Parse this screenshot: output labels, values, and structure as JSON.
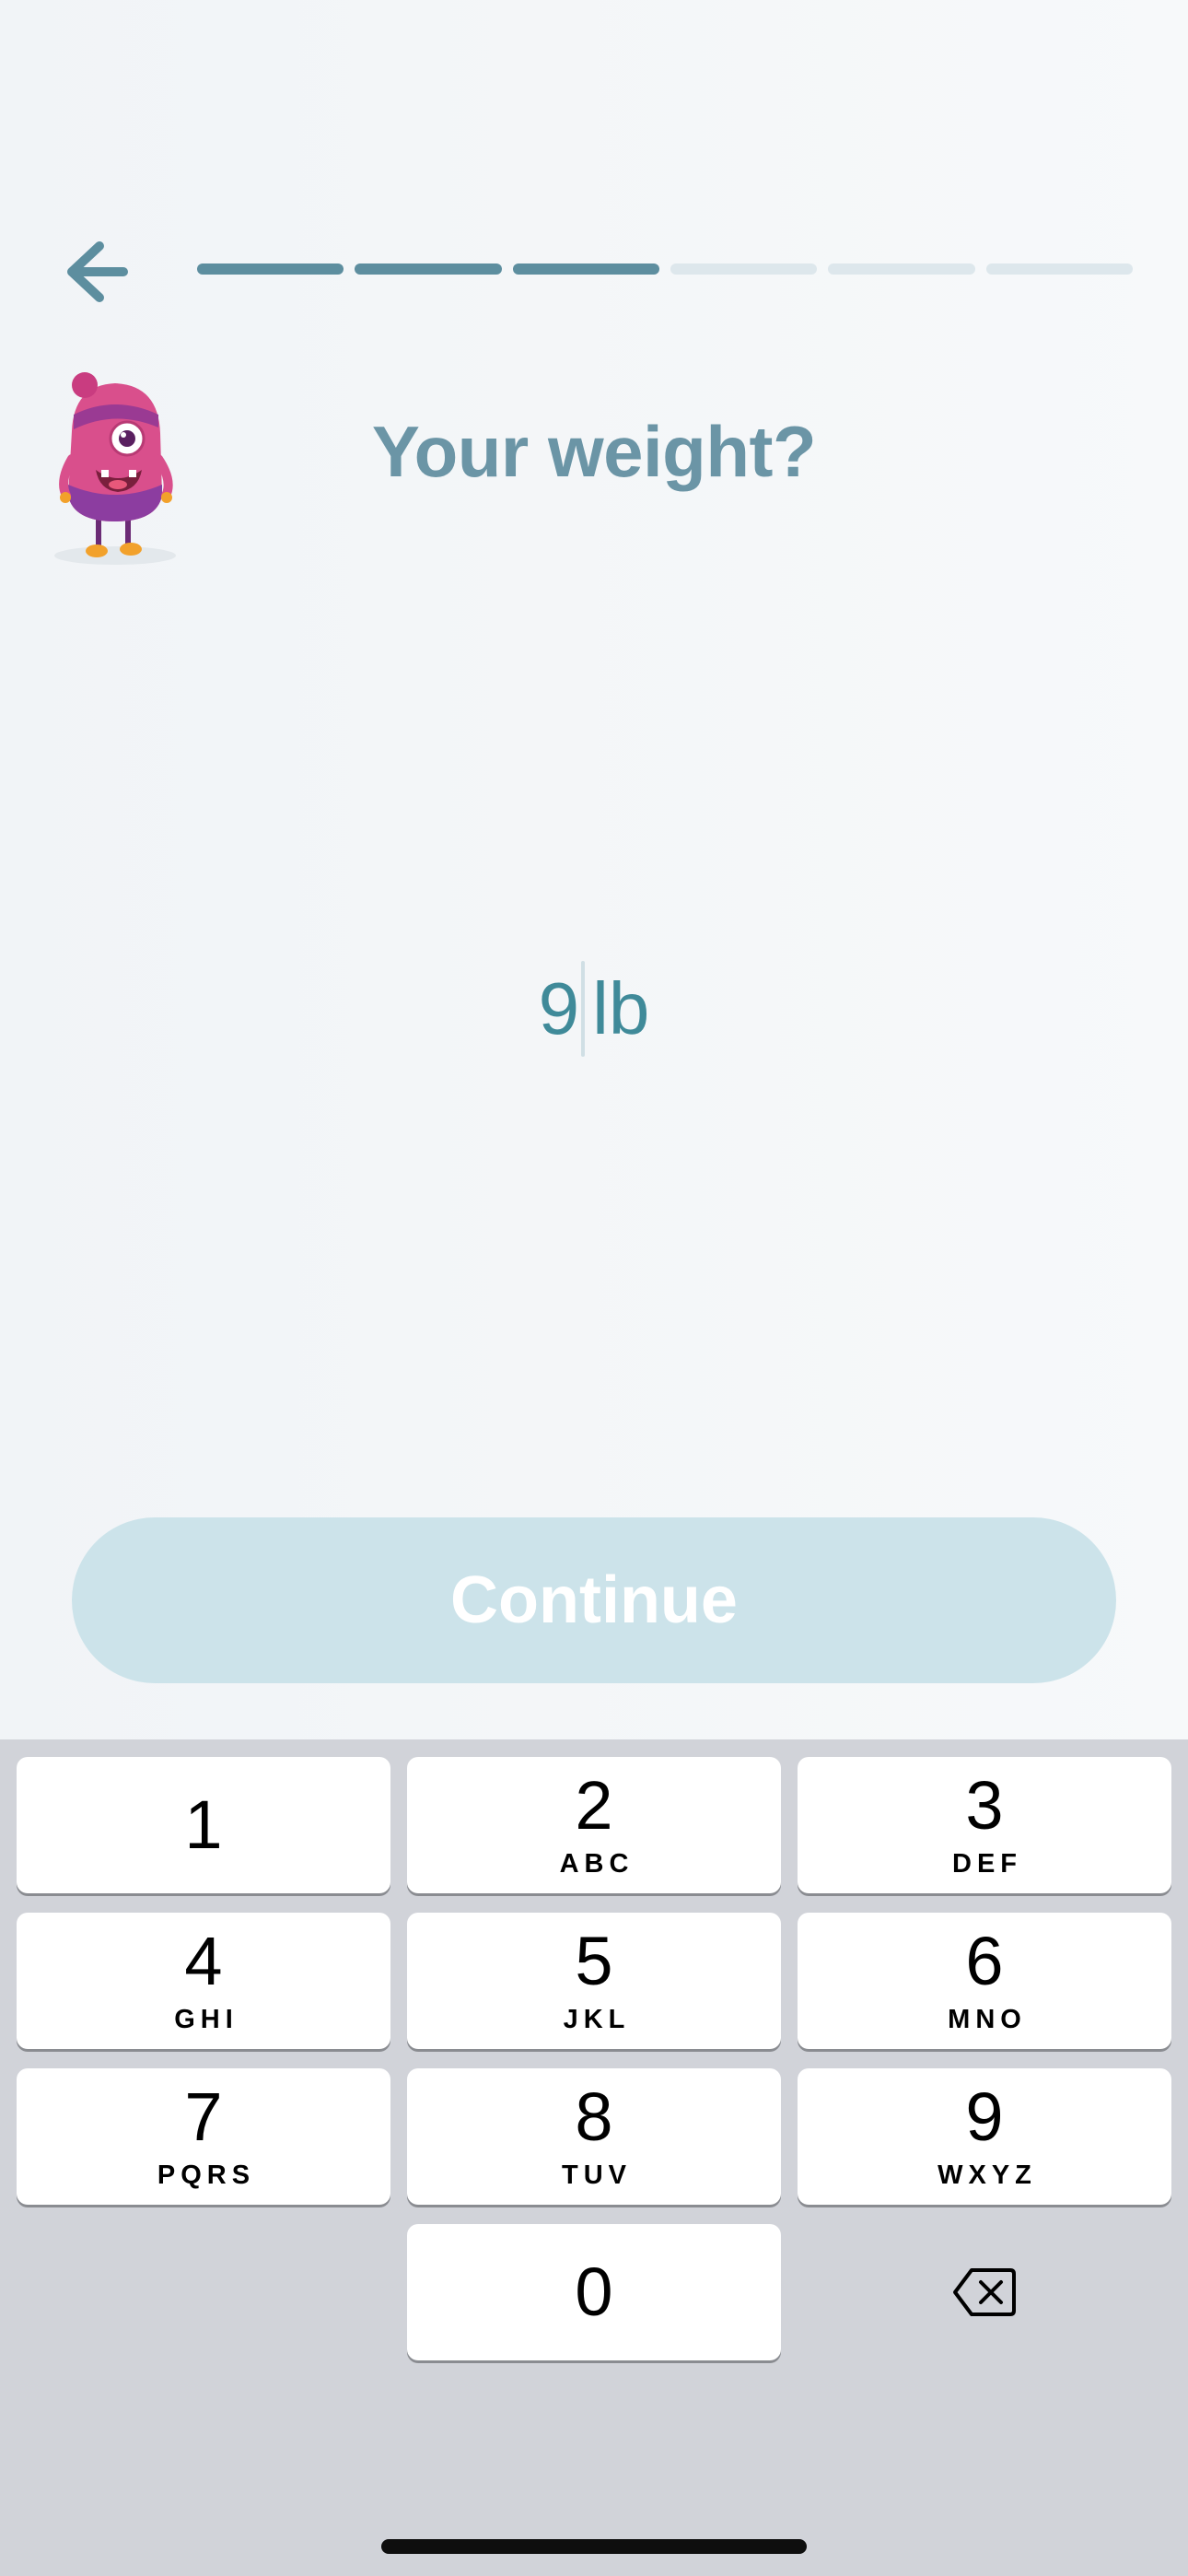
{
  "header": {
    "back_icon": "arrow-left-icon",
    "progress": {
      "total_steps": 6,
      "completed_steps": 3
    }
  },
  "question": {
    "title": "Your weight?",
    "mascot": "pink-monster-mascot"
  },
  "weight_input": {
    "value": "9",
    "unit": "lb"
  },
  "continue_button": {
    "label": "Continue",
    "enabled": false
  },
  "keypad": {
    "keys": [
      {
        "digit": "1",
        "letters": ""
      },
      {
        "digit": "2",
        "letters": "ABC"
      },
      {
        "digit": "3",
        "letters": "DEF"
      },
      {
        "digit": "4",
        "letters": "GHI"
      },
      {
        "digit": "5",
        "letters": "JKL"
      },
      {
        "digit": "6",
        "letters": "MNO"
      },
      {
        "digit": "7",
        "letters": "PQRS"
      },
      {
        "digit": "8",
        "letters": "TUV"
      },
      {
        "digit": "9",
        "letters": "WXYZ"
      },
      {
        "digit": "0",
        "letters": ""
      }
    ],
    "delete_icon": "backspace-icon"
  },
  "colors": {
    "accent": "#5d8e9f",
    "title": "#6b95a6",
    "value": "#3f8a99",
    "continue_disabled": "#cce3ea",
    "keyboard_bg": "#d1d3d9"
  }
}
